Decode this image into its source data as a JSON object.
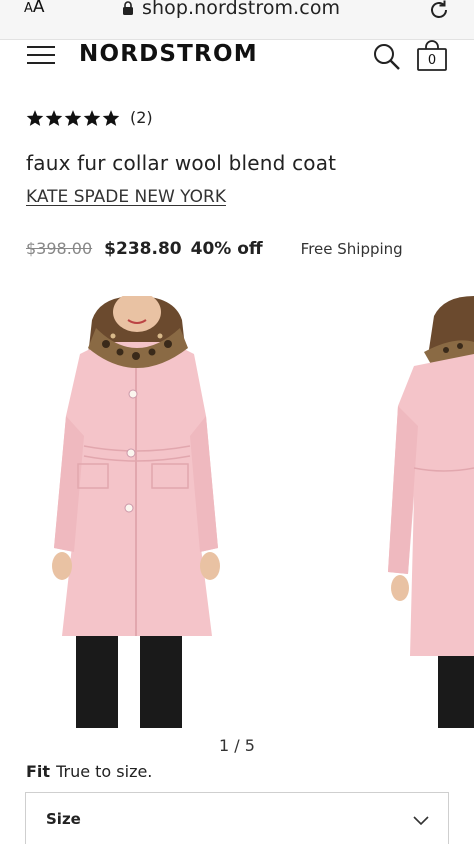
{
  "browser": {
    "text_size_label_small": "A",
    "text_size_label_large": "A",
    "url": "shop.nordstrom.com"
  },
  "header": {
    "logo": "NORDSTROM",
    "bag_count": "0"
  },
  "product": {
    "rating_stars": 5,
    "rating_count": "(2)",
    "title": "faux fur collar wool blend coat",
    "brand": "KATE SPADE NEW YORK",
    "original_price": "$398.00",
    "sale_price": "$238.80",
    "discount": "40% off",
    "shipping": "Free Shipping"
  },
  "gallery": {
    "pagination": "1 / 5",
    "coat_color": "#f4c4c9",
    "collar_color": "#8a6a44"
  },
  "fit": {
    "label": "Fit",
    "value": "True to size."
  },
  "size_select": {
    "label": "Size"
  }
}
